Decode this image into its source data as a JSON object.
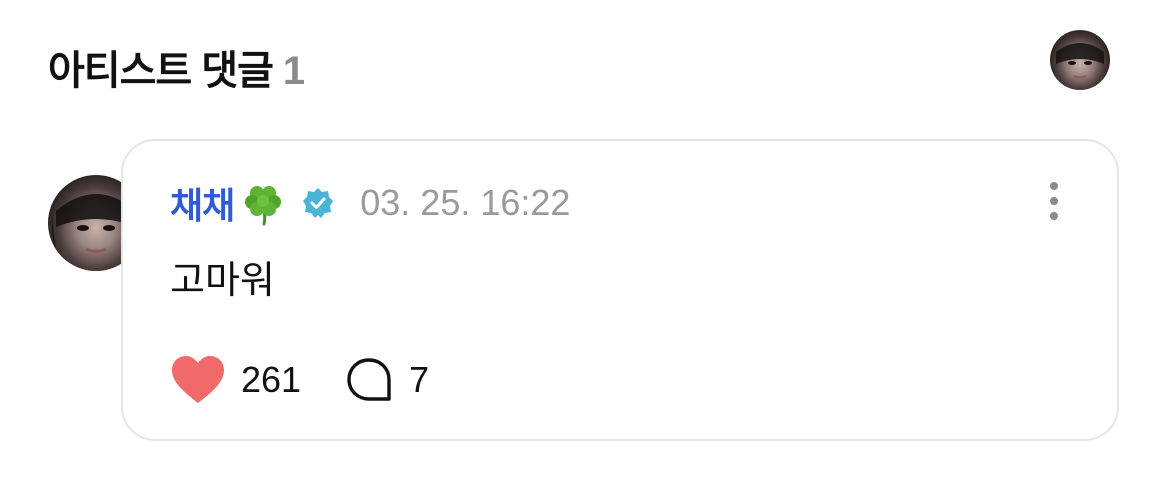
{
  "header": {
    "title": "아티스트 댓글",
    "count": "1"
  },
  "comment": {
    "author": "채채",
    "author_emoji_icon": "four-leaf-clover-icon",
    "verified_icon": "verified-badge-icon",
    "timestamp": "03. 25. 16:22",
    "text": "고마워",
    "likes": "261",
    "replies": "7"
  },
  "colors": {
    "author": "#2f5bd6",
    "verified": "#4ab3d6",
    "heart": "#f06a6a",
    "timestamp": "#9a9a9e",
    "header_count": "#8a8a8a",
    "card_border": "#e5e5e8"
  },
  "icons": {
    "more": "more-vertical-icon",
    "like": "heart-icon",
    "reply": "speech-bubble-icon"
  }
}
